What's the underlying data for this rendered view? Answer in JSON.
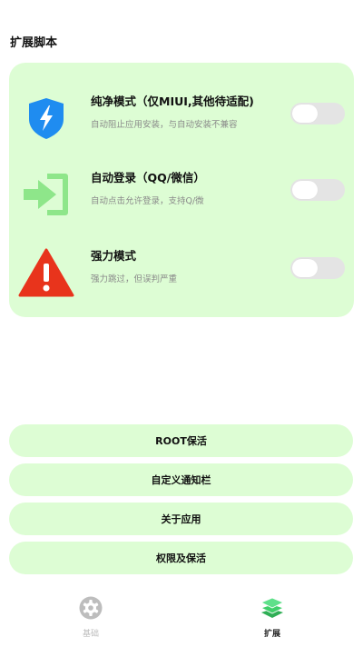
{
  "page": {
    "title": "扩展脚本"
  },
  "features": [
    {
      "icon": "lightning-shield-icon",
      "title": "纯净模式（仅MIUI,其他待适配)",
      "description": "自动阻止应用安装，与自动安装不兼容",
      "enabled": false
    },
    {
      "icon": "login-arrow-icon",
      "title": "自动登录（QQ/微信）",
      "description": "自动点击允许登录，支持Q/微",
      "enabled": false
    },
    {
      "icon": "warning-icon",
      "title": "强力模式",
      "description": "强力跳过，但误判严重",
      "enabled": false
    }
  ],
  "menu": [
    {
      "label": "ROOT保活"
    },
    {
      "label": "自定义通知栏"
    },
    {
      "label": "关于应用"
    },
    {
      "label": "权限及保活"
    }
  ],
  "bottom_nav": {
    "items": [
      {
        "label": "基础",
        "icon": "gear-icon",
        "active": false
      },
      {
        "label": "扩展",
        "icon": "layers-icon",
        "active": true
      }
    ]
  },
  "colors": {
    "card_bg": "#ddfdd4",
    "toggle_off": "#e4e4e4",
    "shield_blue": "#1f8cf0",
    "login_green": "#8ee68a",
    "warning_red": "#e8341c",
    "nav_active": "#3fcf6a",
    "nav_inactive": "#bdbdbd"
  }
}
